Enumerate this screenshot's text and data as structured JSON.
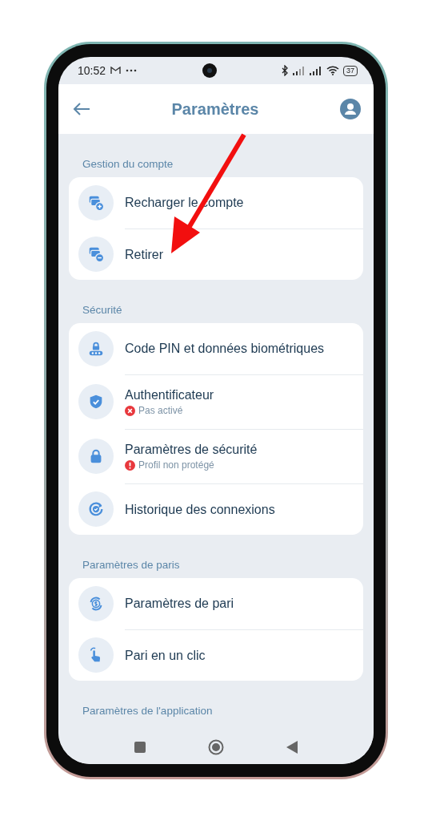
{
  "status_bar": {
    "time": "10:52",
    "battery": "37"
  },
  "header": {
    "title": "Paramètres"
  },
  "sections": [
    {
      "title": "Gestion du compte",
      "items": [
        {
          "label": "Recharger le compte"
        },
        {
          "label": "Retirer"
        }
      ]
    },
    {
      "title": "Sécurité",
      "items": [
        {
          "label": "Code PIN et données biométriques"
        },
        {
          "label": "Authentificateur",
          "status": {
            "kind": "error",
            "text": "Pas activé"
          }
        },
        {
          "label": "Paramètres de sécurité",
          "status": {
            "kind": "warning",
            "text": "Profil non protégé"
          }
        },
        {
          "label": "Historique des connexions"
        }
      ]
    },
    {
      "title": "Paramètres de paris",
      "items": [
        {
          "label": "Paramètres de pari"
        },
        {
          "label": "Pari en un clic"
        }
      ]
    },
    {
      "title": "Paramètres de l'application"
    }
  ]
}
